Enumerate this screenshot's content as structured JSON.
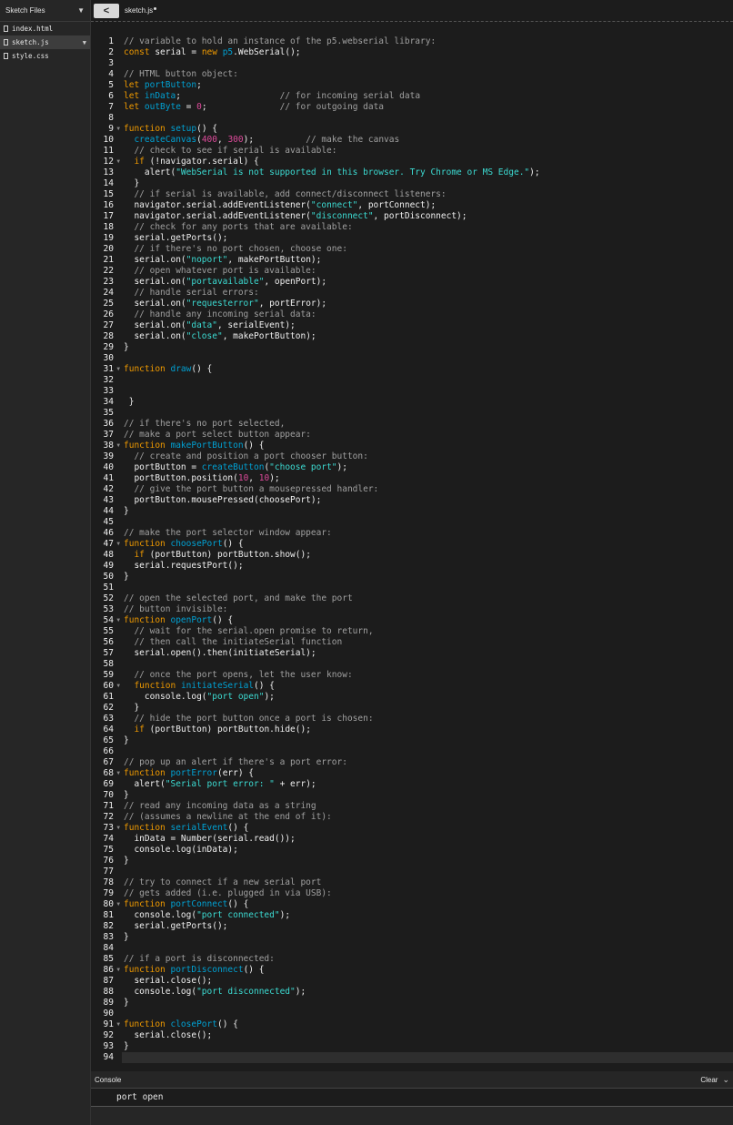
{
  "sidebar": {
    "title": "Sketch Files",
    "files": [
      {
        "name": "index.html",
        "active": false
      },
      {
        "name": "sketch.js",
        "active": true
      },
      {
        "name": "style.css",
        "active": false
      }
    ]
  },
  "tab": {
    "back_label": "<",
    "filename": "sketch.js"
  },
  "console": {
    "title": "Console",
    "clear_label": "Clear",
    "output": [
      "port open"
    ]
  },
  "current_line": 94,
  "code": [
    [
      [
        "c",
        "// variable to hold an instance of the p5.webserial library:"
      ]
    ],
    [
      [
        "k",
        "const "
      ],
      [
        "p",
        "serial = "
      ],
      [
        "k",
        "new "
      ],
      [
        "f",
        "p5"
      ],
      [
        "p",
        ".WebSerial();"
      ]
    ],
    [],
    [
      [
        "c",
        "// HTML button object:"
      ]
    ],
    [
      [
        "k",
        "let "
      ],
      [
        "f",
        "portButton"
      ],
      [
        "p",
        ";"
      ]
    ],
    [
      [
        "k",
        "let "
      ],
      [
        "f",
        "inData"
      ],
      [
        "p",
        ";                   "
      ],
      [
        "c",
        "// for incoming serial data"
      ]
    ],
    [
      [
        "k",
        "let "
      ],
      [
        "f",
        "outByte"
      ],
      [
        "p",
        " = "
      ],
      [
        "n",
        "0"
      ],
      [
        "p",
        ";              "
      ],
      [
        "c",
        "// for outgoing data"
      ]
    ],
    [],
    [
      [
        "k",
        "function "
      ],
      [
        "f",
        "setup"
      ],
      [
        "p",
        "() {"
      ]
    ],
    [
      [
        "p",
        "  "
      ],
      [
        "f",
        "createCanvas"
      ],
      [
        "p",
        "("
      ],
      [
        "n",
        "400"
      ],
      [
        "p",
        ", "
      ],
      [
        "n",
        "300"
      ],
      [
        "p",
        ");          "
      ],
      [
        "c",
        "// make the canvas"
      ]
    ],
    [
      [
        "c",
        "  // check to see if serial is available:"
      ]
    ],
    [
      [
        "p",
        "  "
      ],
      [
        "k",
        "if "
      ],
      [
        "p",
        "(!navigator.serial) {"
      ]
    ],
    [
      [
        "p",
        "    alert("
      ],
      [
        "s",
        "\"WebSerial is not supported in this browser. Try Chrome or MS Edge.\""
      ],
      [
        "p",
        ");"
      ]
    ],
    [
      [
        "p",
        "  }"
      ]
    ],
    [
      [
        "c",
        "  // if serial is available, add connect/disconnect listeners:"
      ]
    ],
    [
      [
        "p",
        "  navigator.serial.addEventListener("
      ],
      [
        "s",
        "\"connect\""
      ],
      [
        "p",
        ", portConnect);"
      ]
    ],
    [
      [
        "p",
        "  navigator.serial.addEventListener("
      ],
      [
        "s",
        "\"disconnect\""
      ],
      [
        "p",
        ", portDisconnect);"
      ]
    ],
    [
      [
        "c",
        "  // check for any ports that are available:"
      ]
    ],
    [
      [
        "p",
        "  serial.getPorts();"
      ]
    ],
    [
      [
        "c",
        "  // if there's no port chosen, choose one:"
      ]
    ],
    [
      [
        "p",
        "  serial.on("
      ],
      [
        "s",
        "\"noport\""
      ],
      [
        "p",
        ", makePortButton);"
      ]
    ],
    [
      [
        "c",
        "  // open whatever port is available:"
      ]
    ],
    [
      [
        "p",
        "  serial.on("
      ],
      [
        "s",
        "\"portavailable\""
      ],
      [
        "p",
        ", openPort);"
      ]
    ],
    [
      [
        "c",
        "  // handle serial errors:"
      ]
    ],
    [
      [
        "p",
        "  serial.on("
      ],
      [
        "s",
        "\"requesterror\""
      ],
      [
        "p",
        ", portError);"
      ]
    ],
    [
      [
        "c",
        "  // handle any incoming serial data:"
      ]
    ],
    [
      [
        "p",
        "  serial.on("
      ],
      [
        "s",
        "\"data\""
      ],
      [
        "p",
        ", serialEvent);"
      ]
    ],
    [
      [
        "p",
        "  serial.on("
      ],
      [
        "s",
        "\"close\""
      ],
      [
        "p",
        ", makePortButton);"
      ]
    ],
    [
      [
        "p",
        "}"
      ]
    ],
    [],
    [
      [
        "k",
        "function "
      ],
      [
        "f",
        "draw"
      ],
      [
        "p",
        "() {"
      ]
    ],
    [],
    [],
    [
      [
        "p",
        " }"
      ]
    ],
    [],
    [
      [
        "c",
        "// if there's no port selected,"
      ]
    ],
    [
      [
        "c",
        "// make a port select button appear:"
      ]
    ],
    [
      [
        "k",
        "function "
      ],
      [
        "f",
        "makePortButton"
      ],
      [
        "p",
        "() {"
      ]
    ],
    [
      [
        "c",
        "  // create and position a port chooser button:"
      ]
    ],
    [
      [
        "p",
        "  portButton = "
      ],
      [
        "f",
        "createButton"
      ],
      [
        "p",
        "("
      ],
      [
        "s",
        "\"choose port\""
      ],
      [
        "p",
        ");"
      ]
    ],
    [
      [
        "p",
        "  portButton.position("
      ],
      [
        "n",
        "10"
      ],
      [
        "p",
        ", "
      ],
      [
        "n",
        "10"
      ],
      [
        "p",
        ");"
      ]
    ],
    [
      [
        "c",
        "  // give the port button a mousepressed handler:"
      ]
    ],
    [
      [
        "p",
        "  portButton.mousePressed(choosePort);"
      ]
    ],
    [
      [
        "p",
        "}"
      ]
    ],
    [],
    [
      [
        "c",
        "// make the port selector window appear:"
      ]
    ],
    [
      [
        "k",
        "function "
      ],
      [
        "f",
        "choosePort"
      ],
      [
        "p",
        "() {"
      ]
    ],
    [
      [
        "p",
        "  "
      ],
      [
        "k",
        "if "
      ],
      [
        "p",
        "(portButton) portButton.show();"
      ]
    ],
    [
      [
        "p",
        "  serial.requestPort();"
      ]
    ],
    [
      [
        "p",
        "}"
      ]
    ],
    [],
    [
      [
        "c",
        "// open the selected port, and make the port"
      ]
    ],
    [
      [
        "c",
        "// button invisible:"
      ]
    ],
    [
      [
        "k",
        "function "
      ],
      [
        "f",
        "openPort"
      ],
      [
        "p",
        "() {"
      ]
    ],
    [
      [
        "c",
        "  // wait for the serial.open promise to return,"
      ]
    ],
    [
      [
        "c",
        "  // then call the initiateSerial function"
      ]
    ],
    [
      [
        "p",
        "  serial.open().then(initiateSerial);"
      ]
    ],
    [],
    [
      [
        "c",
        "  // once the port opens, let the user know:"
      ]
    ],
    [
      [
        "p",
        "  "
      ],
      [
        "k",
        "function "
      ],
      [
        "f",
        "initiateSerial"
      ],
      [
        "p",
        "() {"
      ]
    ],
    [
      [
        "p",
        "    console.log("
      ],
      [
        "s",
        "\"port open\""
      ],
      [
        "p",
        ");"
      ]
    ],
    [
      [
        "p",
        "  }"
      ]
    ],
    [
      [
        "c",
        "  // hide the port button once a port is chosen:"
      ]
    ],
    [
      [
        "p",
        "  "
      ],
      [
        "k",
        "if "
      ],
      [
        "p",
        "(portButton) portButton.hide();"
      ]
    ],
    [
      [
        "p",
        "}"
      ]
    ],
    [],
    [
      [
        "c",
        "// pop up an alert if there's a port error:"
      ]
    ],
    [
      [
        "k",
        "function "
      ],
      [
        "f",
        "portError"
      ],
      [
        "p",
        "(err) {"
      ]
    ],
    [
      [
        "p",
        "  alert("
      ],
      [
        "s",
        "\"Serial port error: \""
      ],
      [
        "p",
        " + err);"
      ]
    ],
    [
      [
        "p",
        "}"
      ]
    ],
    [
      [
        "c",
        "// read any incoming data as a string"
      ]
    ],
    [
      [
        "c",
        "// (assumes a newline at the end of it):"
      ]
    ],
    [
      [
        "k",
        "function "
      ],
      [
        "f",
        "serialEvent"
      ],
      [
        "p",
        "() {"
      ]
    ],
    [
      [
        "p",
        "  inData = Number(serial.read());"
      ]
    ],
    [
      [
        "p",
        "  console.log(inData);"
      ]
    ],
    [
      [
        "p",
        "}"
      ]
    ],
    [],
    [
      [
        "c",
        "// try to connect if a new serial port"
      ]
    ],
    [
      [
        "c",
        "// gets added (i.e. plugged in via USB):"
      ]
    ],
    [
      [
        "k",
        "function "
      ],
      [
        "f",
        "portConnect"
      ],
      [
        "p",
        "() {"
      ]
    ],
    [
      [
        "p",
        "  console.log("
      ],
      [
        "s",
        "\"port connected\""
      ],
      [
        "p",
        ");"
      ]
    ],
    [
      [
        "p",
        "  serial.getPorts();"
      ]
    ],
    [
      [
        "p",
        "}"
      ]
    ],
    [],
    [
      [
        "c",
        "// if a port is disconnected:"
      ]
    ],
    [
      [
        "k",
        "function "
      ],
      [
        "f",
        "portDisconnect"
      ],
      [
        "p",
        "() {"
      ]
    ],
    [
      [
        "p",
        "  serial.close();"
      ]
    ],
    [
      [
        "p",
        "  console.log("
      ],
      [
        "s",
        "\"port disconnected\""
      ],
      [
        "p",
        ");"
      ]
    ],
    [
      [
        "p",
        "}"
      ]
    ],
    [],
    [
      [
        "k",
        "function "
      ],
      [
        "f",
        "closePort"
      ],
      [
        "p",
        "() {"
      ]
    ],
    [
      [
        "p",
        "  serial.close();"
      ]
    ],
    [
      [
        "p",
        "}"
      ]
    ],
    []
  ],
  "fold_lines": [
    9,
    12,
    31,
    38,
    47,
    54,
    60,
    68,
    73,
    80,
    86,
    91
  ]
}
